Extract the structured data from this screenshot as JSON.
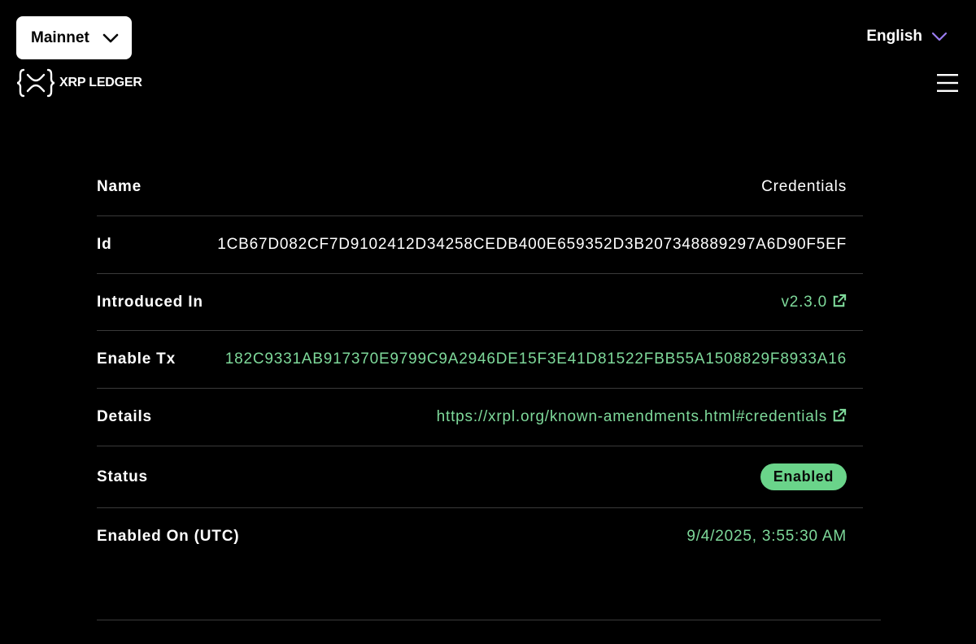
{
  "header": {
    "network_label": "Mainnet",
    "logo_text": "XRP LEDGER",
    "language_label": "English"
  },
  "amendment": {
    "name": {
      "label": "Name",
      "value": "Credentials"
    },
    "id": {
      "label": "Id",
      "value": "1CB67D082CF7D9102412D34258CEDB400E659352D3B207348889297A6D90F5EF"
    },
    "introduced_in": {
      "label": "Introduced In",
      "value": "v2.3.0"
    },
    "enable_tx": {
      "label": "Enable Tx",
      "value": "182C9331AB917370E9799C9A2946DE15F3E41D81522FBB55A1508829F8933A16"
    },
    "details": {
      "label": "Details",
      "value": "https://xrpl.org/known-amendments.html#credentials"
    },
    "status": {
      "label": "Status",
      "value": "Enabled"
    },
    "enabled_on": {
      "label": "Enabled On (UTC)",
      "value": "9/4/2025, 3:55:30 AM"
    }
  },
  "colors": {
    "background": "#000000",
    "link_green": "#7ed99a",
    "badge_green": "#6ad48a",
    "accent_purple": "#9a7cf0",
    "divider": "#3a3a3a"
  },
  "icons": {
    "network_chevron": "chevron-down-icon",
    "language_chevron": "chevron-down-icon",
    "menu": "hamburger-menu-icon",
    "external_link": "external-link-icon",
    "logo": "xrp-logo-icon"
  }
}
